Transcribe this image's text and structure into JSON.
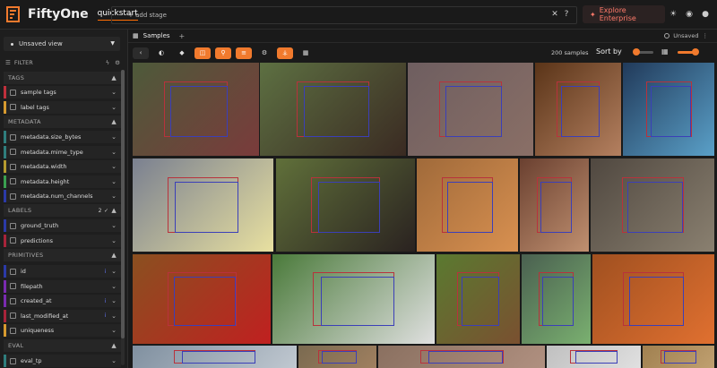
{
  "app": {
    "title": "FiftyOne",
    "dataset": "quickstart",
    "add_stage": "+ add stage",
    "explore": "Explore Enterprise"
  },
  "sidebar": {
    "view": "Unsaved view",
    "filter_label": "FILTER",
    "sections": {
      "tags": "TAGS",
      "metadata": "METADATA",
      "labels": "LABELS",
      "labels_badge": "2 ✓",
      "primitives": "PRIMITIVES",
      "eval": "EVAL"
    },
    "tags": [
      {
        "label": "sample tags",
        "color": "#c0303c"
      },
      {
        "label": "label tags",
        "color": "#d69a2f"
      }
    ],
    "metadata": [
      {
        "label": "metadata.size_bytes",
        "color": "#2f7e7d"
      },
      {
        "label": "metadata.mime_type",
        "color": "#2f7e7d"
      },
      {
        "label": "metadata.width",
        "color": "#b59b2f"
      },
      {
        "label": "metadata.height",
        "color": "#3aa050"
      },
      {
        "label": "metadata.num_channels",
        "color": "#2b3aa8"
      }
    ],
    "labels": [
      {
        "label": "ground_truth",
        "color": "#2b3aa8"
      },
      {
        "label": "predictions",
        "color": "#a8243a"
      }
    ],
    "primitives": [
      {
        "label": "id",
        "color": "#2b3aa8"
      },
      {
        "label": "filepath",
        "color": "#7a2bb0"
      },
      {
        "label": "created_at",
        "color": "#7a2bb0"
      },
      {
        "label": "last_modified_at",
        "color": "#a8243a"
      },
      {
        "label": "uniqueness",
        "color": "#d69a2f"
      }
    ],
    "eval": [
      {
        "label": "eval_tp",
        "color": "#2f7e7d"
      }
    ]
  },
  "main": {
    "tab": "Samples",
    "tab_add": "+",
    "unsaved": "Unsaved",
    "samples_count": "200 samples",
    "sort_by": "Sort by"
  },
  "tiles": [
    {
      "name": "tile-bird",
      "bg": "#4d5a3a",
      "accent": "#7a3b3b"
    },
    {
      "name": "tile-horse-rider",
      "bg": "#5d7042",
      "accent": "#3a2a22"
    },
    {
      "name": "tile-cat-bed",
      "bg": "#6e5e60",
      "accent": "#8a6f66"
    },
    {
      "name": "tile-food-table",
      "bg": "#5a3418",
      "accent": "#b48060"
    },
    {
      "name": "tile-cake",
      "bg": "#213a5a",
      "accent": "#5aa0c8"
    },
    {
      "name": "tile-train",
      "bg": "#7a8090",
      "accent": "#e8e0a0"
    },
    {
      "name": "tile-cow",
      "bg": "#60703a",
      "accent": "#2a2220"
    },
    {
      "name": "tile-cat-mirror",
      "bg": "#a06a3a",
      "accent": "#d89050"
    },
    {
      "name": "tile-man-portrait",
      "bg": "#6a4030",
      "accent": "#c09070"
    },
    {
      "name": "tile-cat-bowl",
      "bg": "#504840",
      "accent": "#8a8070"
    },
    {
      "name": "tile-pizza-plate",
      "bg": "#8a5020",
      "accent": "#c02020"
    },
    {
      "name": "tile-dogs",
      "bg": "#4a7a3a",
      "accent": "#e0e0e0"
    },
    {
      "name": "tile-bear",
      "bg": "#5a7a30",
      "accent": "#7a5030"
    },
    {
      "name": "tile-teddy",
      "bg": "#4a6050",
      "accent": "#7ab070"
    },
    {
      "name": "tile-pizza",
      "bg": "#a05020",
      "accent": "#e07030"
    },
    {
      "name": "tile-bottom-1",
      "bg": "#8090a0",
      "accent": "#c0c8d0"
    },
    {
      "name": "tile-bottom-2",
      "bg": "#7a6a50",
      "accent": "#a08060"
    },
    {
      "name": "tile-bottom-3",
      "bg": "#8a7060",
      "accent": "#b09080"
    },
    {
      "name": "tile-bottom-4",
      "bg": "#c0c0c0",
      "accent": "#e0e0e0"
    },
    {
      "name": "tile-bottom-5",
      "bg": "#a08050",
      "accent": "#c0a070"
    }
  ]
}
